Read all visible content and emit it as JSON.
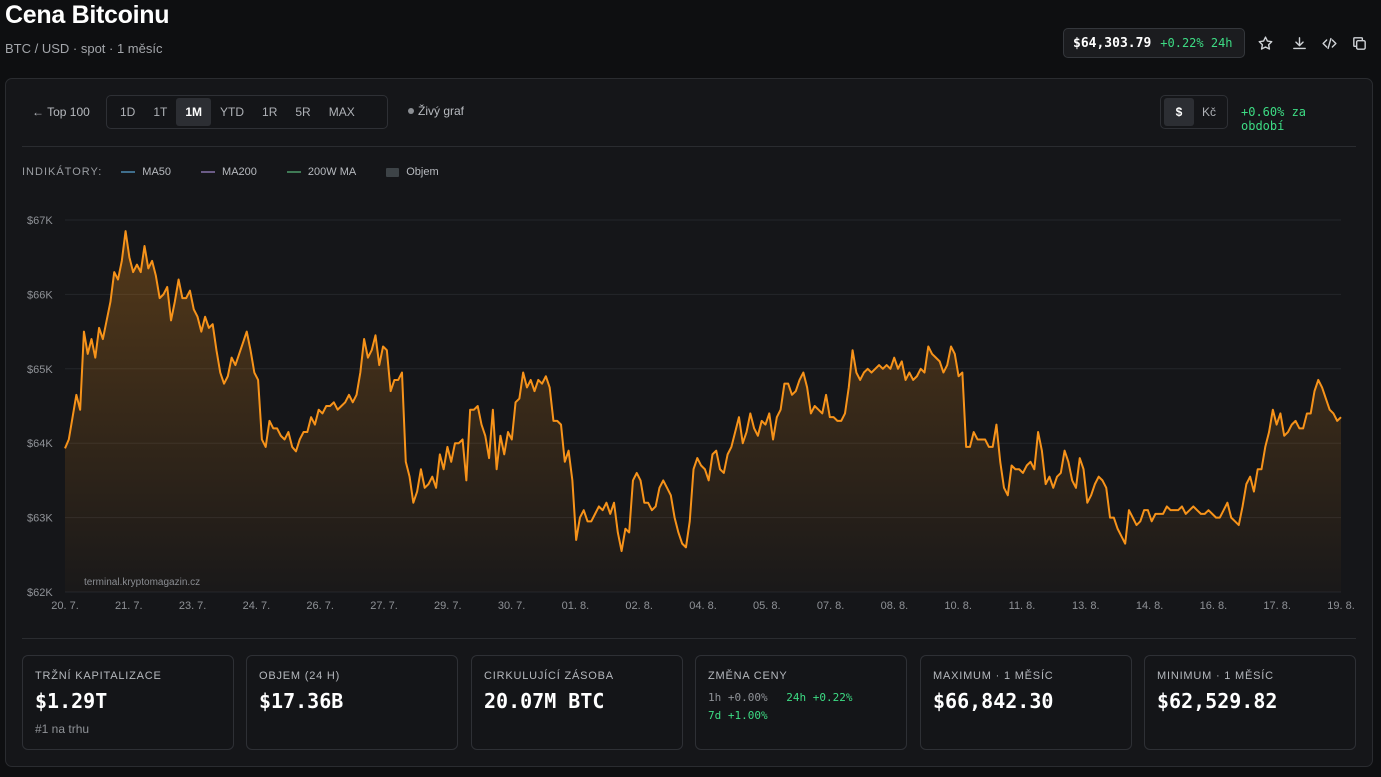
{
  "header": {
    "title": "Cena Bitcoinu",
    "subtitle": "BTC / USD · spot · 1 měsíc",
    "price": "$64,303.79",
    "price_change": "+0.22% 24h"
  },
  "toolbar": {
    "back_label": "← Top 100",
    "ranges": [
      "1D",
      "1T",
      "1M",
      "YTD",
      "1R",
      "5R",
      "MAX"
    ],
    "active_range": "1M",
    "live_label": "Živý graf",
    "currencies": [
      "$",
      "Kč"
    ],
    "active_currency": "$",
    "period_change": "+0.60% za období"
  },
  "indicators": {
    "title": "INDIKÁTORY:",
    "items": [
      {
        "label": "MA50",
        "color": "#3f6e8c"
      },
      {
        "label": "MA200",
        "color": "#6a5b86"
      },
      {
        "label": "200W MA",
        "color": "#3f7a55"
      },
      {
        "label": "Objem",
        "color": "#3d4347"
      }
    ]
  },
  "chart_data": {
    "type": "area",
    "title": "",
    "xlabel": "",
    "ylabel": "",
    "ylim": [
      62000,
      67000
    ],
    "grid": true,
    "line_color": "#f7931a",
    "y_ticks": [
      "$62K",
      "$63K",
      "$64K",
      "$65K",
      "$66K",
      "$67K"
    ],
    "x_ticks": [
      "20. 7.",
      "21. 7.",
      "23. 7.",
      "24. 7.",
      "26. 7.",
      "27. 7.",
      "29. 7.",
      "30. 7.",
      "01. 8.",
      "02. 8.",
      "04. 8.",
      "05. 8.",
      "07. 8.",
      "08. 8.",
      "10. 8.",
      "11. 8.",
      "13. 8.",
      "14. 8.",
      "16. 8.",
      "17. 8.",
      "19. 8."
    ],
    "values": [
      63930,
      64050,
      64350,
      64650,
      64450,
      65500,
      65200,
      65400,
      65150,
      65550,
      65400,
      65650,
      65900,
      66300,
      66200,
      66450,
      66850,
      66500,
      66300,
      66400,
      66300,
      66650,
      66350,
      66450,
      66250,
      65950,
      66000,
      66100,
      65650,
      65900,
      66200,
      65950,
      65950,
      66050,
      65800,
      65700,
      65500,
      65700,
      65550,
      65600,
      65250,
      64950,
      64800,
      64900,
      65150,
      65050,
      65200,
      65350,
      65500,
      65250,
      64950,
      64850,
      64050,
      63950,
      64300,
      64200,
      64200,
      64100,
      64050,
      64150,
      63950,
      63890,
      64050,
      64150,
      64150,
      64350,
      64250,
      64450,
      64400,
      64500,
      64500,
      64550,
      64450,
      64500,
      64550,
      64650,
      64550,
      64650,
      64950,
      65400,
      65150,
      65250,
      65450,
      65050,
      65300,
      65250,
      64700,
      64850,
      64850,
      64950,
      63750,
      63550,
      63200,
      63350,
      63650,
      63400,
      63450,
      63550,
      63400,
      63850,
      63650,
      63950,
      63750,
      64000,
      64000,
      64050,
      63500,
      64450,
      64450,
      64500,
      64250,
      64100,
      63800,
      64450,
      63650,
      64100,
      63850,
      64150,
      64050,
      64550,
      64600,
      64950,
      64750,
      64850,
      64700,
      64850,
      64800,
      64900,
      64750,
      64300,
      64300,
      64250,
      63750,
      63900,
      63500,
      62700,
      63000,
      63100,
      62950,
      62950,
      63050,
      63150,
      63100,
      63200,
      63050,
      63200,
      62800,
      62550,
      62850,
      62800,
      63500,
      63600,
      63500,
      63200,
      63200,
      63100,
      63150,
      63400,
      63500,
      63400,
      63300,
      63000,
      62800,
      62650,
      62600,
      62950,
      63650,
      63800,
      63700,
      63650,
      63500,
      63850,
      63900,
      63650,
      63600,
      63850,
      63950,
      64150,
      64350,
      64000,
      64150,
      64400,
      64200,
      64100,
      64300,
      64250,
      64400,
      64050,
      64350,
      64450,
      64800,
      64800,
      64650,
      64700,
      64850,
      64950,
      64750,
      64400,
      64500,
      64450,
      64400,
      64650,
      64350,
      64350,
      64300,
      64300,
      64400,
      64750,
      65250,
      64950,
      64850,
      64950,
      65000,
      64950,
      65000,
      65050,
      65000,
      65050,
      65000,
      65150,
      65000,
      65100,
      64850,
      64950,
      64850,
      64900,
      65000,
      64950,
      65300,
      65200,
      65150,
      65100,
      64950,
      65050,
      65300,
      65200,
      64900,
      64950,
      63950,
      63950,
      64150,
      64050,
      64050,
      64050,
      63950,
      63950,
      64250,
      63750,
      63400,
      63300,
      63700,
      63650,
      63650,
      63600,
      63700,
      63750,
      63650,
      64150,
      63900,
      63450,
      63550,
      63400,
      63550,
      63600,
      63900,
      63750,
      63500,
      63400,
      63800,
      63650,
      63200,
      63300,
      63450,
      63550,
      63500,
      63400,
      63000,
      63000,
      62850,
      62750,
      62650,
      63100,
      63000,
      62900,
      62950,
      63100,
      63100,
      62950,
      63050,
      63050,
      63050,
      63150,
      63100,
      63100,
      63100,
      63150,
      63050,
      63100,
      63150,
      63100,
      63050,
      63050,
      63100,
      63050,
      63000,
      63000,
      63100,
      63200,
      63000,
      62950,
      62900,
      63150,
      63450,
      63550,
      63350,
      63650,
      63650,
      63950,
      64150,
      64450,
      64250,
      64400,
      64100,
      64150,
      64250,
      64300,
      64200,
      64200,
      64400,
      64400,
      64700,
      64850,
      64750,
      64600,
      64450,
      64400,
      64300,
      64350
    ]
  },
  "watermark": "terminal.kryptomagazin.cz",
  "stats": [
    {
      "label": "TRŽNÍ KAPITALIZACE",
      "value": "$1.29T",
      "sub": "#1 na trhu"
    },
    {
      "label": "OBJEM (24 H)",
      "value": "$17.36B"
    },
    {
      "label": "CIRKULUJÍCÍ ZÁSOBA",
      "value": "20.07M BTC"
    },
    {
      "label": "ZMĚNA CENY",
      "changes": [
        {
          "label": "1h",
          "value": "+0.00%",
          "color": "#8f9297"
        },
        {
          "label": "24h",
          "value": "+0.22%",
          "color": "#3ddc84"
        },
        {
          "label": "7d",
          "value": "+1.00%",
          "color": "#3ddc84"
        }
      ]
    },
    {
      "label": "MAXIMUM · 1 MĚSÍC",
      "value": "$66,842.30"
    },
    {
      "label": "MINIMUM · 1 MĚSÍC",
      "value": "$62,529.82"
    }
  ]
}
